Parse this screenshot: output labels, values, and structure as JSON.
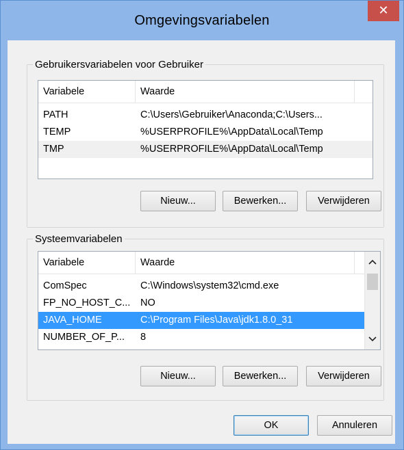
{
  "window": {
    "title": "Omgevingsvariabelen",
    "close_label": "✕"
  },
  "user_vars": {
    "group_label": "Gebruikersvariabelen voor Gebruiker",
    "columns": [
      "Variabele",
      "Waarde"
    ],
    "rows": [
      {
        "name": "PATH",
        "value": "C:\\Users\\Gebruiker\\Anaconda;C:\\Users..."
      },
      {
        "name": "TEMP",
        "value": "%USERPROFILE%\\AppData\\Local\\Temp"
      },
      {
        "name": "TMP",
        "value": "%USERPROFILE%\\AppData\\Local\\Temp"
      }
    ],
    "buttons": {
      "new": "Nieuw...",
      "edit": "Bewerken...",
      "delete": "Verwijderen"
    }
  },
  "system_vars": {
    "group_label": "Systeemvariabelen",
    "columns": [
      "Variabele",
      "Waarde"
    ],
    "rows": [
      {
        "name": "ComSpec",
        "value": "C:\\Windows\\system32\\cmd.exe"
      },
      {
        "name": "FP_NO_HOST_C...",
        "value": "NO"
      },
      {
        "name": "JAVA_HOME",
        "value": "C:\\Program Files\\Java\\jdk1.8.0_31"
      },
      {
        "name": "NUMBER_OF_P...",
        "value": "8"
      }
    ],
    "selected_row": "JAVA_HOME",
    "buttons": {
      "new": "Nieuw...",
      "edit": "Bewerken...",
      "delete": "Verwijderen"
    }
  },
  "footer": {
    "ok": "OK",
    "cancel": "Annuleren"
  },
  "colors": {
    "selection": "#3399ff",
    "close_button": "#c7504b",
    "frame": "#8fb6e8"
  }
}
